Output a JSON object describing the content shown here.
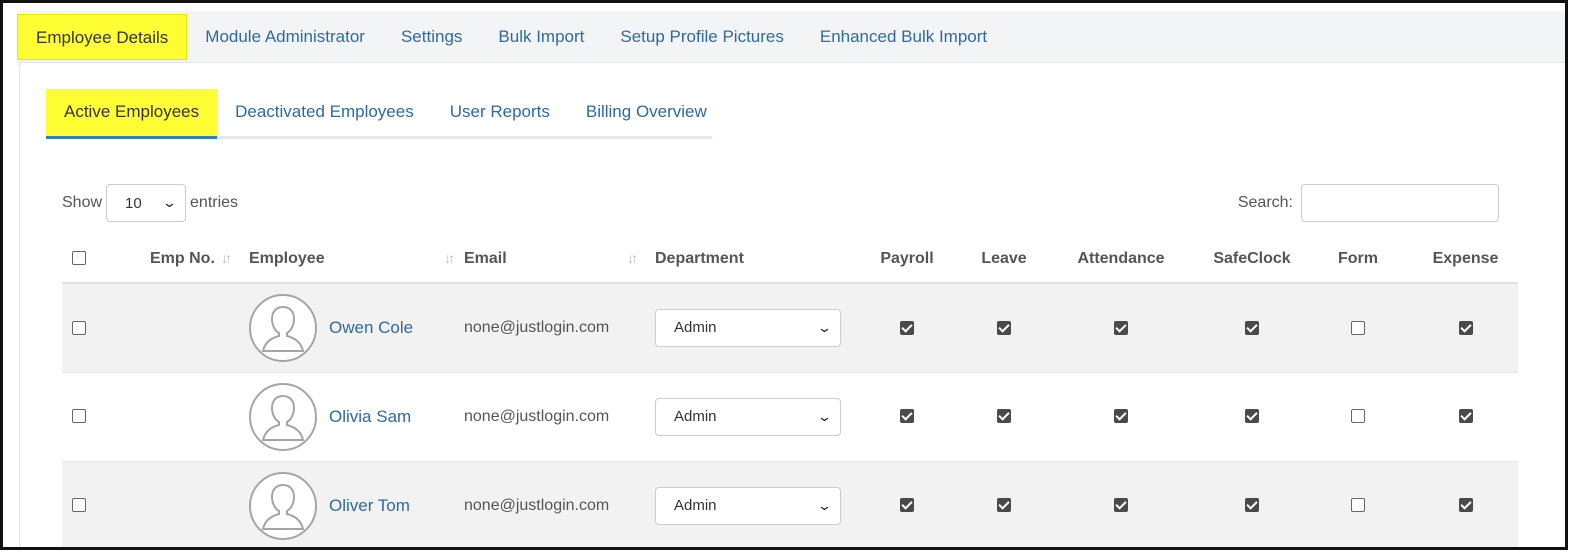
{
  "top_tabs": [
    {
      "label": "Employee Details",
      "active": true
    },
    {
      "label": "Module Administrator",
      "active": false
    },
    {
      "label": "Settings",
      "active": false
    },
    {
      "label": "Bulk Import",
      "active": false
    },
    {
      "label": "Setup Profile Pictures",
      "active": false
    },
    {
      "label": "Enhanced Bulk Import",
      "active": false
    }
  ],
  "sub_tabs": [
    {
      "label": "Active Employees",
      "active": true
    },
    {
      "label": "Deactivated Employees",
      "active": false
    },
    {
      "label": "User Reports",
      "active": false
    },
    {
      "label": "Billing Overview",
      "active": false
    }
  ],
  "length": {
    "show_label": "Show",
    "value": "10",
    "entries_label": "entries"
  },
  "search": {
    "label": "Search:",
    "value": ""
  },
  "columns": {
    "emp_no": "Emp No.",
    "employee": "Employee",
    "email": "Email",
    "department": "Department",
    "payroll": "Payroll",
    "leave": "Leave",
    "attendance": "Attendance",
    "safeclock": "SafeClock",
    "form": "Form",
    "expense": "Expense"
  },
  "rows": [
    {
      "name": "Owen Cole",
      "email": "none@justlogin.com",
      "department": "Admin",
      "payroll": true,
      "leave": true,
      "attendance": true,
      "safeclock": true,
      "form": false,
      "expense": true
    },
    {
      "name": "Olivia Sam",
      "email": "none@justlogin.com",
      "department": "Admin",
      "payroll": true,
      "leave": true,
      "attendance": true,
      "safeclock": true,
      "form": false,
      "expense": true
    },
    {
      "name": "Oliver Tom",
      "email": "none@justlogin.com",
      "department": "Admin",
      "payroll": true,
      "leave": true,
      "attendance": true,
      "safeclock": true,
      "form": false,
      "expense": true
    }
  ],
  "colors": {
    "highlight": "#ffff33",
    "link": "#2f6a9e",
    "active_underline": "#3a7bbf"
  }
}
